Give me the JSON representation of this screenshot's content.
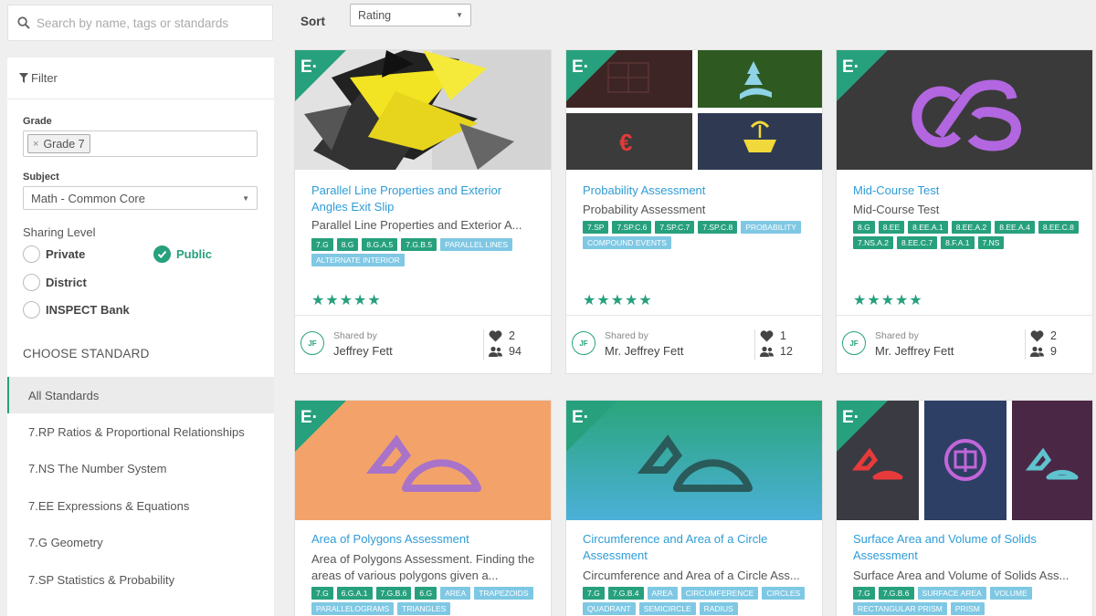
{
  "search": {
    "placeholder": "Search by name, tags or standards"
  },
  "filter": {
    "heading": "Filter",
    "grade_label": "Grade",
    "grade_tag": "Grade 7",
    "grade_remove": "×",
    "subject_label": "Subject",
    "subject_value": "Math - Common Core",
    "sharing_label": "Sharing Level",
    "sharing_options": [
      "Private",
      "Public",
      "District",
      "INSPECT Bank"
    ],
    "sharing_selected": "Public"
  },
  "standards": {
    "heading": "CHOOSE STANDARD",
    "items": [
      "All Standards",
      "7.RP Ratios & Proportional Relationships",
      "7.NS The Number System",
      "7.EE Expressions & Equations",
      "7.G Geometry",
      "7.SP Statistics & Probability"
    ],
    "active": "All Standards"
  },
  "sort": {
    "label": "Sort",
    "value": "Rating"
  },
  "brand_badge": "E·",
  "colors": {
    "accent": "#27a07d",
    "link": "#2e9cd6",
    "keyword_tag": "#7fc8e4"
  },
  "cards": [
    {
      "title": "Parallel Line Properties and Exterior Angles Exit Slip",
      "subtitle": "Parallel Line Properties and Exterior A...",
      "standards": [
        "7.G",
        "8.G",
        "8.G.A.5",
        "7.G.B.5"
      ],
      "keywords": [
        "PARALLEL LINES",
        "ALTERNATE INTERIOR"
      ],
      "stars": "★★★★★",
      "rating": 5,
      "shared_label": "Shared by",
      "author": "Jeffrey Fett",
      "initials": "JF",
      "likes": "2",
      "uses": "94"
    },
    {
      "title": "Probability Assessment",
      "subtitle": "Probability Assessment",
      "standards": [
        "7.SP",
        "7.SP.C.6",
        "7.SP.C.7",
        "7.SP.C.8"
      ],
      "keywords": [
        "PROBABILITY",
        "COMPOUND EVENTS"
      ],
      "stars": "★★★★★",
      "rating": 5,
      "shared_label": "Shared by",
      "author": "Mr. Jeffrey Fett",
      "initials": "JF",
      "likes": "1",
      "uses": "12"
    },
    {
      "title": "Mid-Course Test",
      "subtitle": "Mid-Course Test",
      "standards": [
        "8.G",
        "8.EE",
        "8.EE.A.1",
        "8.EE.A.2",
        "8.EE.A.4",
        "8.EE.C.8",
        "7.NS.A.2",
        "8.EE.C.7",
        "8.F.A.1",
        "7.NS"
      ],
      "keywords": [],
      "stars": "★★★★★",
      "rating": 5,
      "shared_label": "Shared by",
      "author": "Mr. Jeffrey Fett",
      "initials": "JF",
      "likes": "2",
      "uses": "9"
    },
    {
      "title": "Area of Polygons Assessment",
      "subtitle": "Area of Polygons Assessment. Finding the areas of various polygons given a...",
      "standards": [
        "7.G",
        "6.G.A.1",
        "7.G.B.6",
        "6.G"
      ],
      "keywords": [
        "AREA",
        "TRAPEZOIDS",
        "PARALLELOGRAMS",
        "TRIANGLES"
      ]
    },
    {
      "title": "Circumference and Area of a Circle Assessment",
      "subtitle": "Circumference and Area of a Circle Ass...",
      "standards": [
        "7.G",
        "7.G.B.4"
      ],
      "keywords": [
        "AREA",
        "CIRCUMFERENCE",
        "CIRCLES",
        "QUADRANT",
        "SEMICIRCLE",
        "RADIUS"
      ]
    },
    {
      "title": "Surface Area and Volume of Solids Assessment",
      "subtitle": "Surface Area and Volume of Solids Ass...",
      "standards": [
        "7.G",
        "7.G.B.6"
      ],
      "keywords": [
        "SURFACE AREA",
        "VOLUME",
        "RECTANGULAR PRISM",
        "PRISM"
      ]
    }
  ]
}
